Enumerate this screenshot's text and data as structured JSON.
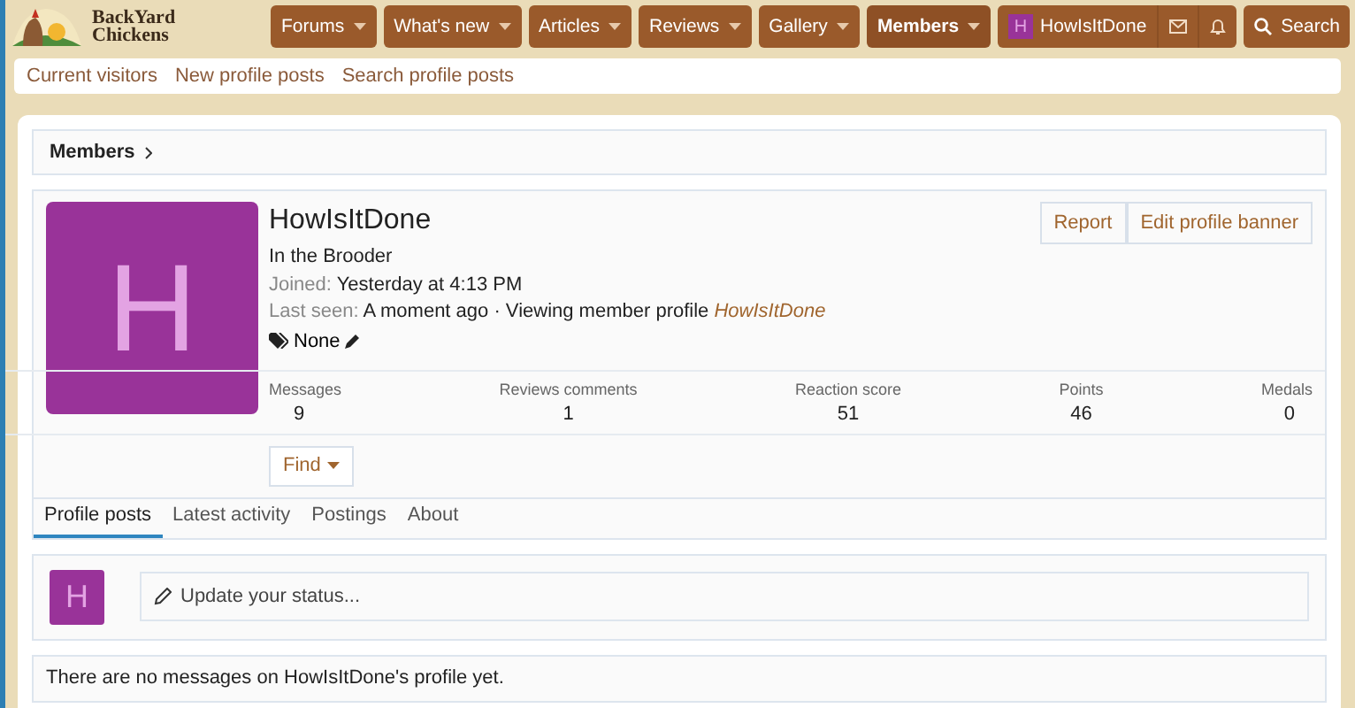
{
  "logo": {
    "line1": "BackYard",
    "line2": "Chickens"
  },
  "nav": [
    {
      "label": "Forums",
      "selected": false
    },
    {
      "label": "What's new",
      "selected": false
    },
    {
      "label": "Articles",
      "selected": false
    },
    {
      "label": "Reviews",
      "selected": false
    },
    {
      "label": "Gallery",
      "selected": false
    },
    {
      "label": "Members",
      "selected": true
    }
  ],
  "account": {
    "avatar_letter": "H",
    "username": "HowIsItDone"
  },
  "search_button": "Search",
  "sub_nav": [
    "Current visitors",
    "New profile posts",
    "Search profile posts"
  ],
  "breadcrumb": [
    "Members"
  ],
  "profile": {
    "avatar_letter": "H",
    "name": "HowIsItDone",
    "user_title": "In the Brooder",
    "joined": {
      "label": "Joined:",
      "value": "Yesterday at 4:13 PM"
    },
    "last_seen": {
      "label": "Last seen:",
      "value": "A moment ago · Viewing member profile ",
      "link": "HowIsItDone"
    },
    "tags": "None",
    "actions": [
      "Report",
      "Edit profile banner"
    ],
    "stats": [
      {
        "label": "Messages",
        "value": "9"
      },
      {
        "label": "Reviews comments",
        "value": "1"
      },
      {
        "label": "Reaction score",
        "value": "51"
      },
      {
        "label": "Points",
        "value": "46"
      },
      {
        "label": "Medals",
        "value": "0"
      }
    ],
    "find_button": "Find"
  },
  "tabs": [
    {
      "label": "Profile posts",
      "selected": true
    },
    {
      "label": "Latest activity",
      "selected": false
    },
    {
      "label": "Postings",
      "selected": false
    },
    {
      "label": "About",
      "selected": false
    }
  ],
  "status": {
    "avatar_letter": "H",
    "placeholder": "Update your status..."
  },
  "empty_message": "There are no messages on HowIsItDone's profile yet."
}
